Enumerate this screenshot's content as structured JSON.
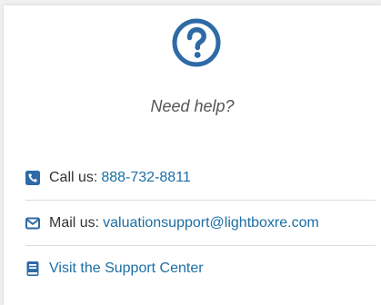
{
  "colors": {
    "accent": "#2e6aa6",
    "link": "#1c6ea4",
    "text": "#333333",
    "muted": "#555555"
  },
  "help": {
    "icon": "question-circle-icon",
    "title": "Need help?"
  },
  "contacts": [
    {
      "icon": "phone-icon",
      "label": "Call us:",
      "value": "888-732-8811"
    },
    {
      "icon": "envelope-icon",
      "label": "Mail us:",
      "value": "valuationsupport@lightboxre.com"
    },
    {
      "icon": "book-icon",
      "label": "",
      "value": "Visit the Support Center"
    }
  ]
}
